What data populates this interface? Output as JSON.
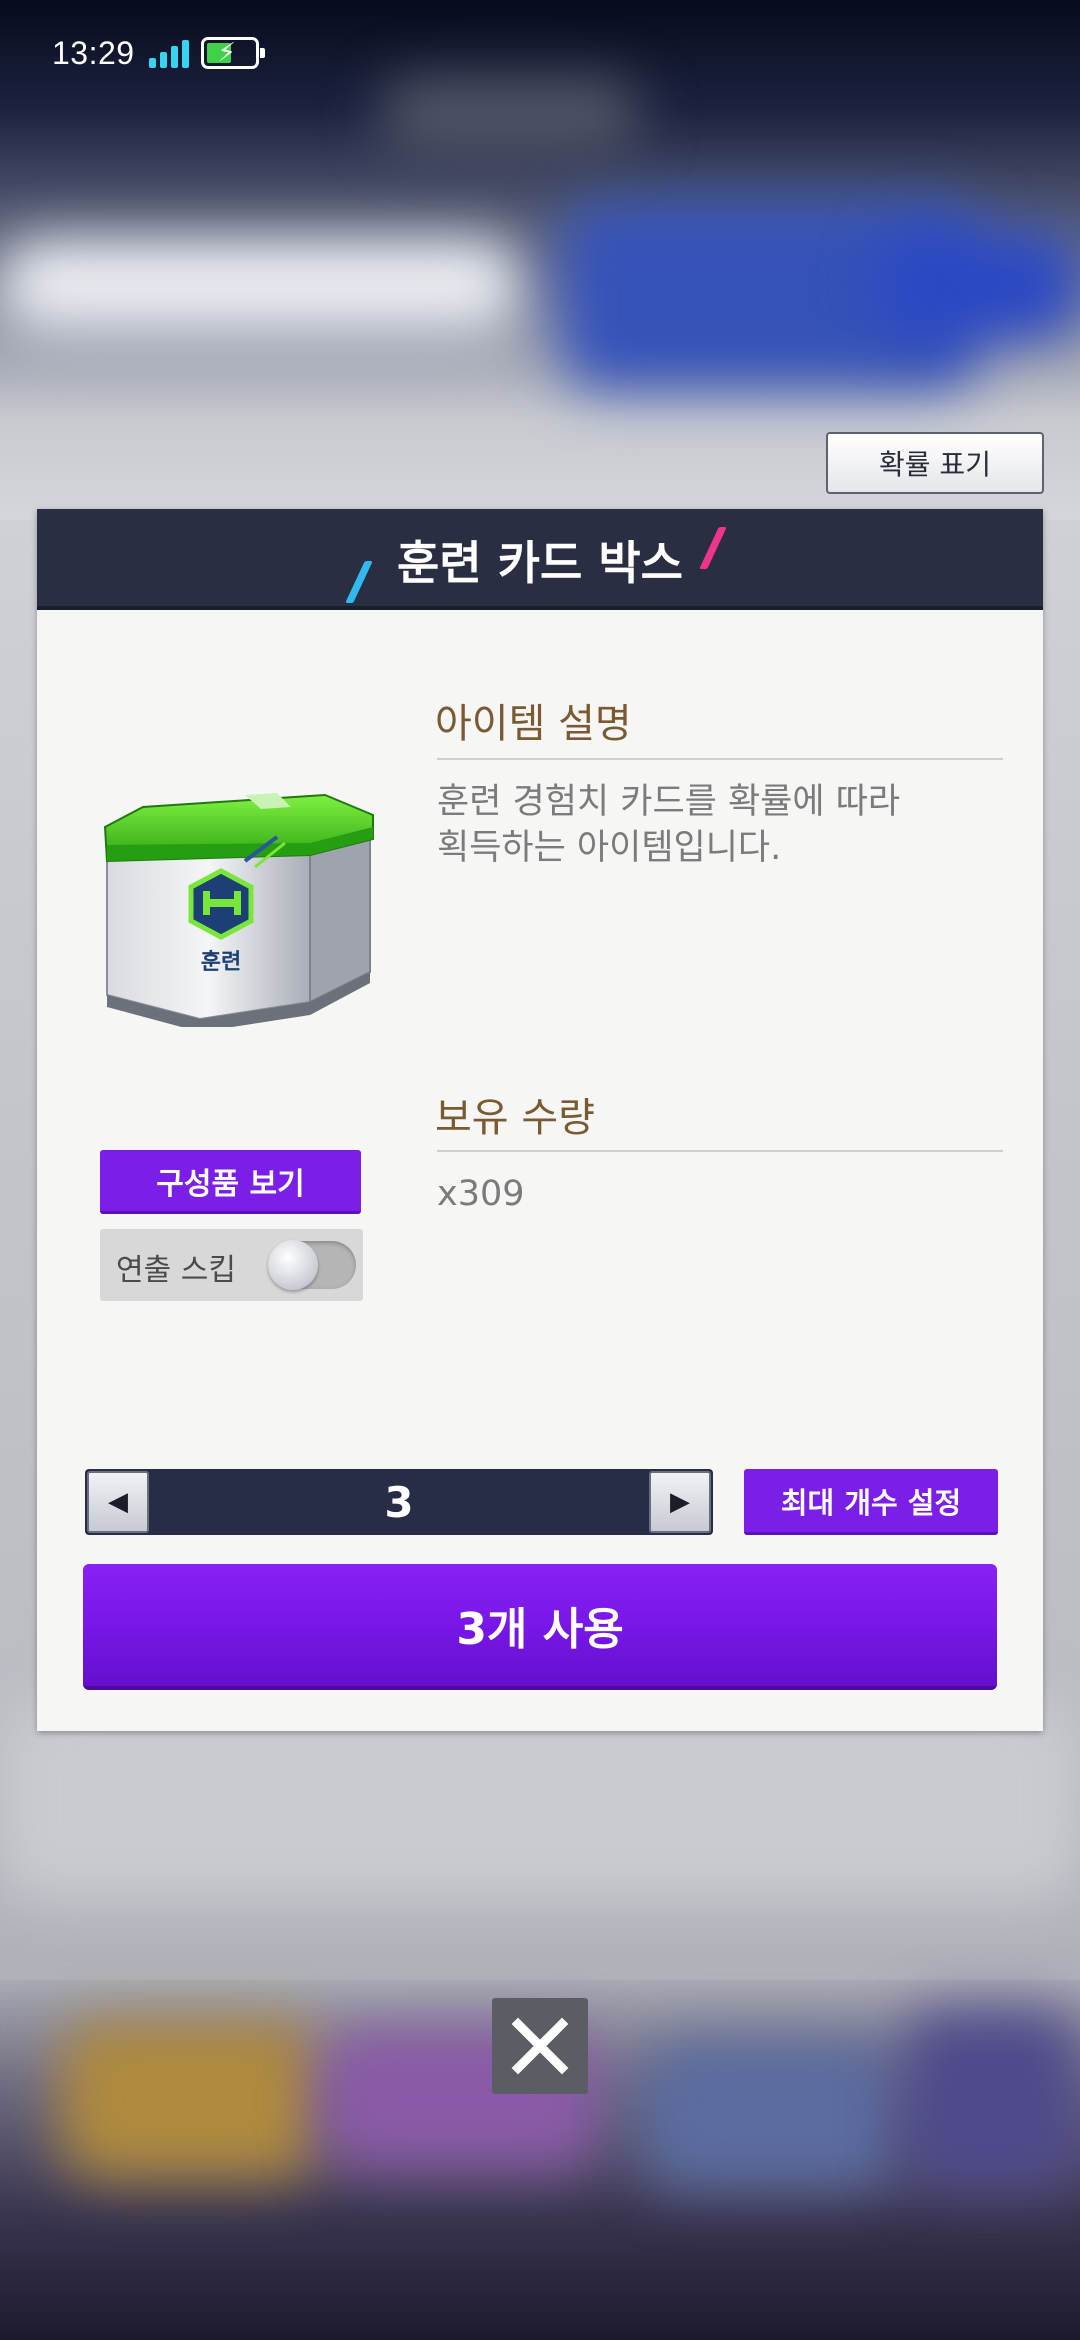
{
  "status_bar": {
    "time": "13:29"
  },
  "probability_button": {
    "label": "확률 표기"
  },
  "dialog": {
    "title": "훈련 카드 박스",
    "item_image_label": "훈련",
    "description": {
      "heading": "아이템 설명",
      "line1": "훈련 경험치 카드를 확률에 따라",
      "line2": "획득하는 아이템입니다."
    },
    "owned": {
      "heading": "보유 수량",
      "value": "x309"
    },
    "components_button": "구성품 보기",
    "skip_animation": {
      "label": "연출 스킵",
      "enabled": false
    },
    "quantity_stepper": {
      "value": "3",
      "decrease_icon": "triangle-left-icon",
      "increase_icon": "triangle-right-icon"
    },
    "max_button": "최대 개수 설정",
    "use_button": "3개 사용"
  },
  "close_button": {
    "icon": "close-icon"
  },
  "colors": {
    "accent_purple": "#7a1ee8",
    "header_navy": "#2a2e42",
    "heading_brown": "#7a5a33"
  }
}
